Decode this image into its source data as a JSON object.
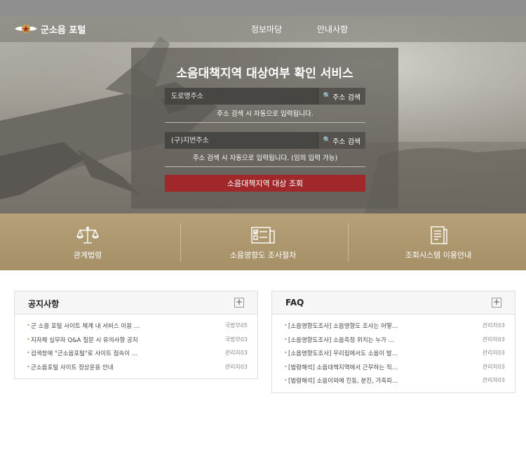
{
  "header": {
    "logo_text": "군소음 포털",
    "menu": [
      "정보마당",
      "안내사항"
    ]
  },
  "search": {
    "title": "소음대책지역 대상여부 확인 서비스",
    "road_placeholder": "도로명주소",
    "jibun_placeholder": "(구)지번주소",
    "search_button": "주소 검색",
    "road_hint": "주소 검색 시 자동으로 입력됩니다.",
    "jibun_hint": "주소 검색 시 자동으로 입력됩니다. (임의 입력 가능)",
    "submit": "소음대책지역 대상 조회"
  },
  "quick": [
    {
      "label": "관계법령",
      "icon": "scales-icon"
    },
    {
      "label": "소음영향도 조사절차",
      "icon": "checklist-icon"
    },
    {
      "label": "조회시스템 이용안내",
      "icon": "document-icon"
    }
  ],
  "notice": {
    "title": "공지사항",
    "more": "+",
    "items": [
      {
        "title": "군 소음 포털 사이트 체계 내 서비스 이용 …",
        "writer": "국방부05"
      },
      {
        "title": "지자체 실무자 Q&A 질문 시 유의사항 공지",
        "writer": "국방부03"
      },
      {
        "title": "검색창에 \"군소음포털\"로 사이트 접속이 …",
        "writer": "관리자03"
      },
      {
        "title": "군소음포털 사이트 정상운용 안내",
        "writer": "관리자03"
      }
    ]
  },
  "faq": {
    "title": "FAQ",
    "more": "+",
    "items": [
      {
        "title": "[소음영향도조사] 소음영향도 조사는 어떻…",
        "writer": "관리자03"
      },
      {
        "title": "[소음영향도조사] 소음측정 위치는 누가 …",
        "writer": "관리자03"
      },
      {
        "title": "[소음영향도조사] 우리집에서도 소음이 발…",
        "writer": "관리자03"
      },
      {
        "title": "[법령해석] 소음대책지역에서 근무하는 직…",
        "writer": "관리자03"
      },
      {
        "title": "[법령해석] 소음이외에 진동, 분진, 가축피…",
        "writer": "관리자03"
      }
    ]
  },
  "colors": {
    "submit": "#a0282a",
    "quick_band": "#a58f68",
    "bullet": "#b39c70"
  }
}
